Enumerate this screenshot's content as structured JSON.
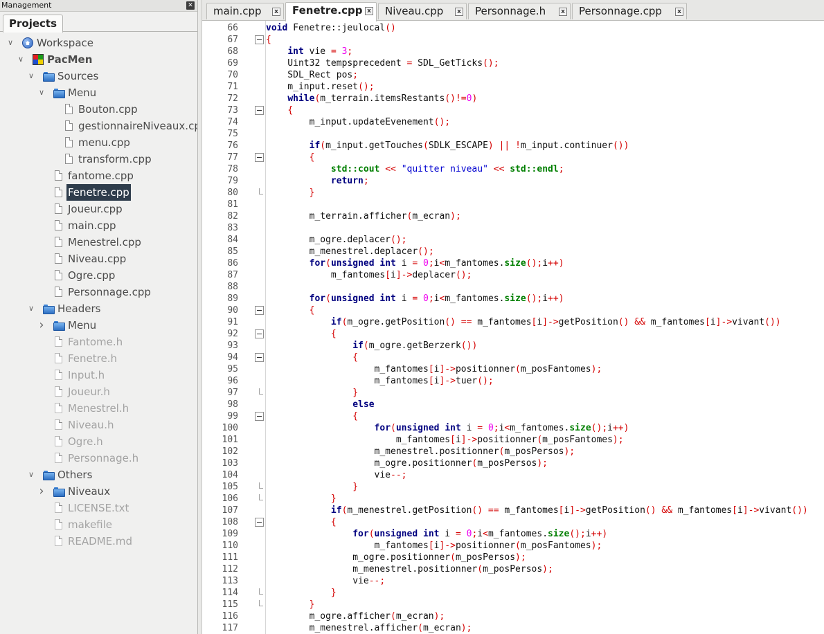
{
  "management": {
    "title": "Management",
    "close_icon": "close-icon",
    "tab": "Projects",
    "tree": [
      {
        "label": "Workspace",
        "level": 0,
        "icon": "workspace",
        "expander": "open"
      },
      {
        "label": "PacMen",
        "level": 1,
        "icon": "project",
        "expander": "open",
        "bold": true
      },
      {
        "label": "Sources",
        "level": 2,
        "icon": "folder",
        "expander": "open"
      },
      {
        "label": "Menu",
        "level": 3,
        "icon": "folder",
        "expander": "open"
      },
      {
        "label": "Bouton.cpp",
        "level": 4,
        "icon": "file"
      },
      {
        "label": "gestionnaireNiveaux.cpp",
        "level": 4,
        "icon": "file"
      },
      {
        "label": "menu.cpp",
        "level": 4,
        "icon": "file"
      },
      {
        "label": "transform.cpp",
        "level": 4,
        "icon": "file"
      },
      {
        "label": "fantome.cpp",
        "level": 3,
        "icon": "file"
      },
      {
        "label": "Fenetre.cpp",
        "level": 3,
        "icon": "file",
        "selected": true
      },
      {
        "label": "Joueur.cpp",
        "level": 3,
        "icon": "file"
      },
      {
        "label": "main.cpp",
        "level": 3,
        "icon": "file"
      },
      {
        "label": "Menestrel.cpp",
        "level": 3,
        "icon": "file"
      },
      {
        "label": "Niveau.cpp",
        "level": 3,
        "icon": "file"
      },
      {
        "label": "Ogre.cpp",
        "level": 3,
        "icon": "file"
      },
      {
        "label": "Personnage.cpp",
        "level": 3,
        "icon": "file"
      },
      {
        "label": "Headers",
        "level": 2,
        "icon": "folder",
        "expander": "open"
      },
      {
        "label": "Menu",
        "level": 3,
        "icon": "folder",
        "expander": "closed"
      },
      {
        "label": "Fantome.h",
        "level": 3,
        "icon": "file",
        "dim": true
      },
      {
        "label": "Fenetre.h",
        "level": 3,
        "icon": "file",
        "dim": true
      },
      {
        "label": "Input.h",
        "level": 3,
        "icon": "file",
        "dim": true
      },
      {
        "label": "Joueur.h",
        "level": 3,
        "icon": "file",
        "dim": true
      },
      {
        "label": "Menestrel.h",
        "level": 3,
        "icon": "file",
        "dim": true
      },
      {
        "label": "Niveau.h",
        "level": 3,
        "icon": "file",
        "dim": true
      },
      {
        "label": "Ogre.h",
        "level": 3,
        "icon": "file",
        "dim": true
      },
      {
        "label": "Personnage.h",
        "level": 3,
        "icon": "file",
        "dim": true
      },
      {
        "label": "Others",
        "level": 2,
        "icon": "folder",
        "expander": "open"
      },
      {
        "label": "Niveaux",
        "level": 3,
        "icon": "folder",
        "expander": "closed"
      },
      {
        "label": "LICENSE.txt",
        "level": 3,
        "icon": "file",
        "dim": true
      },
      {
        "label": "makefile",
        "level": 3,
        "icon": "file",
        "dim": true
      },
      {
        "label": "README.md",
        "level": 3,
        "icon": "file",
        "dim": true
      }
    ]
  },
  "editor": {
    "tabs": [
      {
        "label": "main.cpp",
        "active": false
      },
      {
        "label": "Fenetre.cpp",
        "active": true
      },
      {
        "label": "Niveau.cpp",
        "active": false
      },
      {
        "label": "Personnage.h",
        "active": false
      },
      {
        "label": "Personnage.cpp",
        "active": false
      }
    ],
    "tab_close_glyph": "x",
    "colors": {
      "keyword": "#00007f",
      "operator": "#d40000",
      "number": "#ee00ee",
      "string": "#0000d0",
      "std": "#007f00",
      "selection": "#2f3d4c"
    },
    "lines": [
      {
        "n": 66,
        "fold": "",
        "code": "void Fenetre::jeulocal()"
      },
      {
        "n": 67,
        "fold": "box",
        "code": "{"
      },
      {
        "n": 68,
        "fold": "",
        "code": "    int vie = 3;"
      },
      {
        "n": 69,
        "fold": "",
        "code": "    Uint32 tempsprecedent = SDL_GetTicks();"
      },
      {
        "n": 70,
        "fold": "",
        "code": "    SDL_Rect pos;"
      },
      {
        "n": 71,
        "fold": "",
        "code": "    m_input.reset();"
      },
      {
        "n": 72,
        "fold": "",
        "code": "    while(m_terrain.itemsRestants()!=0)"
      },
      {
        "n": 73,
        "fold": "box",
        "code": "    {"
      },
      {
        "n": 74,
        "fold": "",
        "code": "        m_input.updateEvenement();"
      },
      {
        "n": 75,
        "fold": "",
        "code": ""
      },
      {
        "n": 76,
        "fold": "",
        "code": "        if(m_input.getTouches(SDLK_ESCAPE) || !m_input.continuer())"
      },
      {
        "n": 77,
        "fold": "box",
        "code": "        {"
      },
      {
        "n": 78,
        "fold": "",
        "code": "            std::cout << \"quitter niveau\" << std::endl;"
      },
      {
        "n": 79,
        "fold": "",
        "code": "            return;"
      },
      {
        "n": 80,
        "fold": "end",
        "code": "        }"
      },
      {
        "n": 81,
        "fold": "",
        "code": ""
      },
      {
        "n": 82,
        "fold": "",
        "code": "        m_terrain.afficher(m_ecran);"
      },
      {
        "n": 83,
        "fold": "",
        "code": ""
      },
      {
        "n": 84,
        "fold": "",
        "code": "        m_ogre.deplacer();"
      },
      {
        "n": 85,
        "fold": "",
        "code": "        m_menestrel.deplacer();"
      },
      {
        "n": 86,
        "fold": "",
        "code": "        for(unsigned int i = 0;i<m_fantomes.size();i++)"
      },
      {
        "n": 87,
        "fold": "",
        "code": "            m_fantomes[i]->deplacer();"
      },
      {
        "n": 88,
        "fold": "",
        "code": ""
      },
      {
        "n": 89,
        "fold": "",
        "code": "        for(unsigned int i = 0;i<m_fantomes.size();i++)"
      },
      {
        "n": 90,
        "fold": "box",
        "code": "        {"
      },
      {
        "n": 91,
        "fold": "",
        "code": "            if(m_ogre.getPosition() == m_fantomes[i]->getPosition() && m_fantomes[i]->vivant())"
      },
      {
        "n": 92,
        "fold": "box",
        "code": "            {"
      },
      {
        "n": 93,
        "fold": "",
        "code": "                if(m_ogre.getBerzerk())"
      },
      {
        "n": 94,
        "fold": "box",
        "code": "                {"
      },
      {
        "n": 95,
        "fold": "",
        "code": "                    m_fantomes[i]->positionner(m_posFantomes);"
      },
      {
        "n": 96,
        "fold": "",
        "code": "                    m_fantomes[i]->tuer();"
      },
      {
        "n": 97,
        "fold": "end",
        "code": "                }"
      },
      {
        "n": 98,
        "fold": "",
        "code": "                else"
      },
      {
        "n": 99,
        "fold": "box",
        "code": "                {"
      },
      {
        "n": 100,
        "fold": "",
        "code": "                    for(unsigned int i = 0;i<m_fantomes.size();i++)"
      },
      {
        "n": 101,
        "fold": "",
        "code": "                        m_fantomes[i]->positionner(m_posFantomes);"
      },
      {
        "n": 102,
        "fold": "",
        "code": "                    m_menestrel.positionner(m_posPersos);"
      },
      {
        "n": 103,
        "fold": "",
        "code": "                    m_ogre.positionner(m_posPersos);"
      },
      {
        "n": 104,
        "fold": "",
        "code": "                    vie--;"
      },
      {
        "n": 105,
        "fold": "end",
        "code": "                }"
      },
      {
        "n": 106,
        "fold": "end",
        "code": "            }"
      },
      {
        "n": 107,
        "fold": "",
        "code": "            if(m_menestrel.getPosition() == m_fantomes[i]->getPosition() && m_fantomes[i]->vivant())"
      },
      {
        "n": 108,
        "fold": "box",
        "code": "            {"
      },
      {
        "n": 109,
        "fold": "",
        "code": "                for(unsigned int i = 0;i<m_fantomes.size();i++)"
      },
      {
        "n": 110,
        "fold": "",
        "code": "                    m_fantomes[i]->positionner(m_posFantomes);"
      },
      {
        "n": 111,
        "fold": "",
        "code": "                m_ogre.positionner(m_posPersos);"
      },
      {
        "n": 112,
        "fold": "",
        "code": "                m_menestrel.positionner(m_posPersos);"
      },
      {
        "n": 113,
        "fold": "",
        "code": "                vie--;"
      },
      {
        "n": 114,
        "fold": "end",
        "code": "            }"
      },
      {
        "n": 115,
        "fold": "end",
        "code": "        }"
      },
      {
        "n": 116,
        "fold": "",
        "code": "        m_ogre.afficher(m_ecran);"
      },
      {
        "n": 117,
        "fold": "",
        "code": "        m_menestrel.afficher(m_ecran);"
      }
    ]
  }
}
